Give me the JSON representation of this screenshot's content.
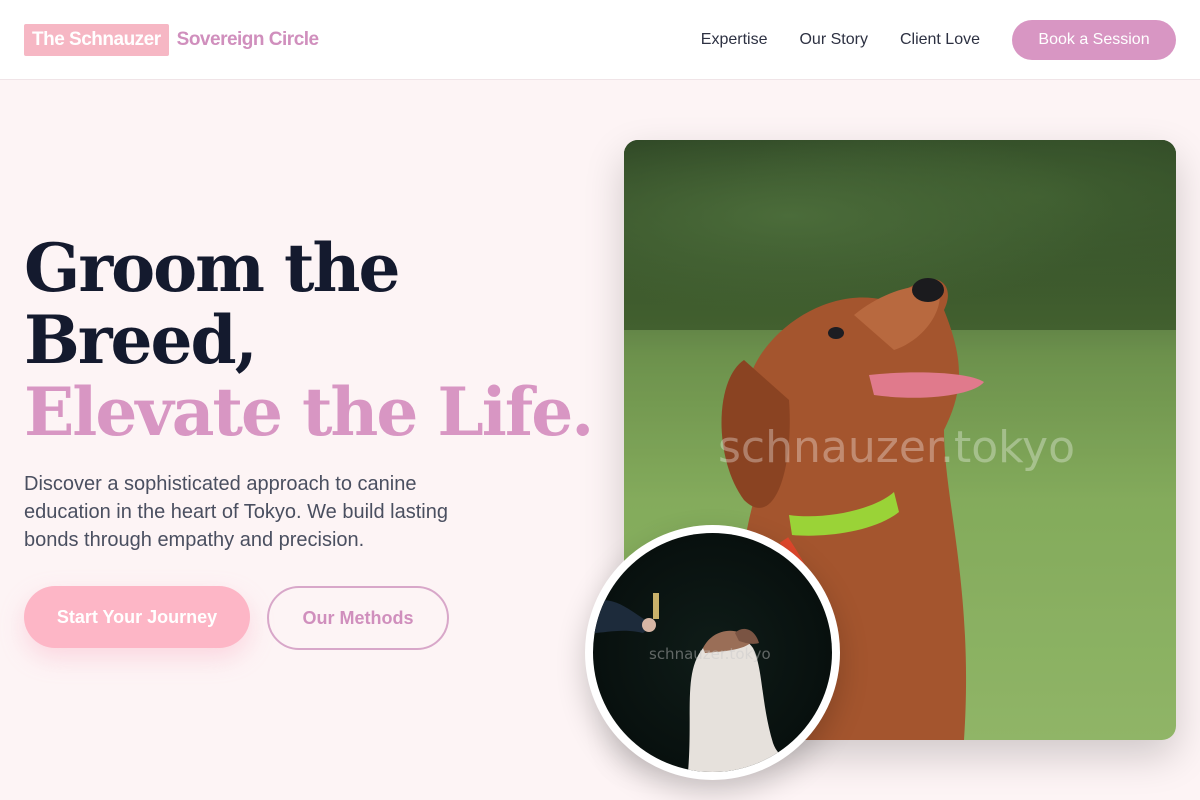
{
  "header": {
    "brand_highlight": "The Schnauzer",
    "brand_rest": "Sovereign Circle",
    "nav": [
      {
        "label": "Expertise"
      },
      {
        "label": "Our Story"
      },
      {
        "label": "Client Love"
      }
    ],
    "cta_label": "Book a Session"
  },
  "hero": {
    "title_line1": "Groom the",
    "title_line2": "Breed,",
    "title_accent": "Elevate the Life.",
    "description": "Discover a sophisticated approach to canine education in the heart of Tokyo. We build lasting bonds through empathy and precision.",
    "primary_button": "Start Your Journey",
    "secondary_button": "Our Methods"
  },
  "images": {
    "main_watermark": "schnauzer.tokyo",
    "inset_watermark": "schnauzer.tokyo"
  },
  "colors": {
    "accent": "#d896c3",
    "primary_button": "#fdb6c6",
    "background": "#fdf4f5",
    "heading": "#141a2e"
  }
}
